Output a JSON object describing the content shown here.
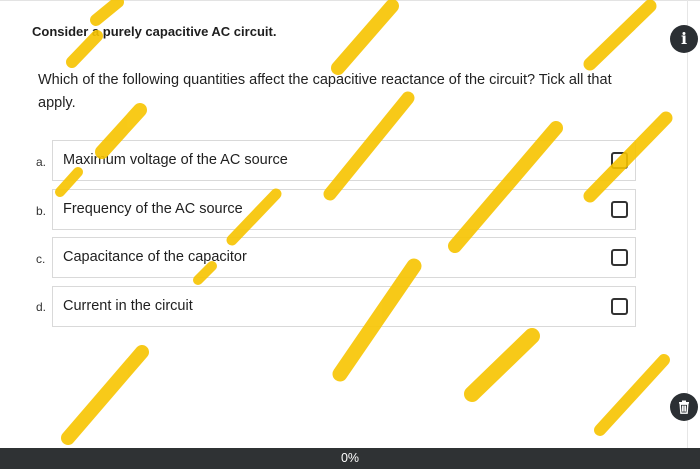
{
  "intro": "Consider a purely capacitive AC circuit.",
  "question": "Which of the following quantities affect the capacitive reactance of the circuit? Tick all that apply.",
  "options": [
    {
      "letter": "a.",
      "label": "Maximum voltage of the AC source",
      "checked": false
    },
    {
      "letter": "b.",
      "label": "Frequency of the AC source",
      "checked": false
    },
    {
      "letter": "c.",
      "label": "Capacitance of the capacitor",
      "checked": false
    },
    {
      "letter": "d.",
      "label": "Current in the circuit",
      "checked": false
    }
  ],
  "buttons": {
    "info_icon": "info-icon",
    "info_glyph": "i",
    "delete_icon": "trash-icon"
  },
  "progress": {
    "label": "0%",
    "fraction": 0
  },
  "colors": {
    "progress_bar": "#2f3234",
    "overlay_marks": "#f7c400"
  }
}
